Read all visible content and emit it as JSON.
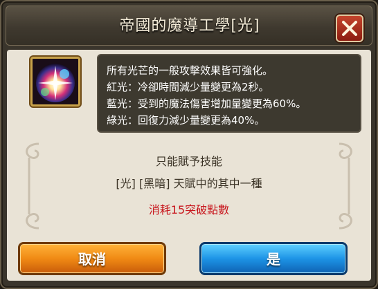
{
  "dialog": {
    "title": "帝國的魔導工學[光]",
    "close_label": "X"
  },
  "skill": {
    "icon": "light-orb-skill-icon",
    "description": [
      "所有光芒的一般攻擊效果皆可強化。",
      "紅光：冷卻時間減少量變更為2秒。",
      "藍光：受到的魔法傷害增加量變更為60%。",
      "綠光：回復力減少量變更為40%。"
    ]
  },
  "info": {
    "restriction": "只能賦予技能",
    "choice": "[光] [黑暗] 天賦中的其中一種",
    "cost": "消耗15突破點數"
  },
  "buttons": {
    "cancel_label": "取消",
    "confirm_label": "是"
  },
  "colors": {
    "cost_text": "#c8161d",
    "cancel_button": "#f08a14",
    "confirm_button": "#1d94e6"
  }
}
